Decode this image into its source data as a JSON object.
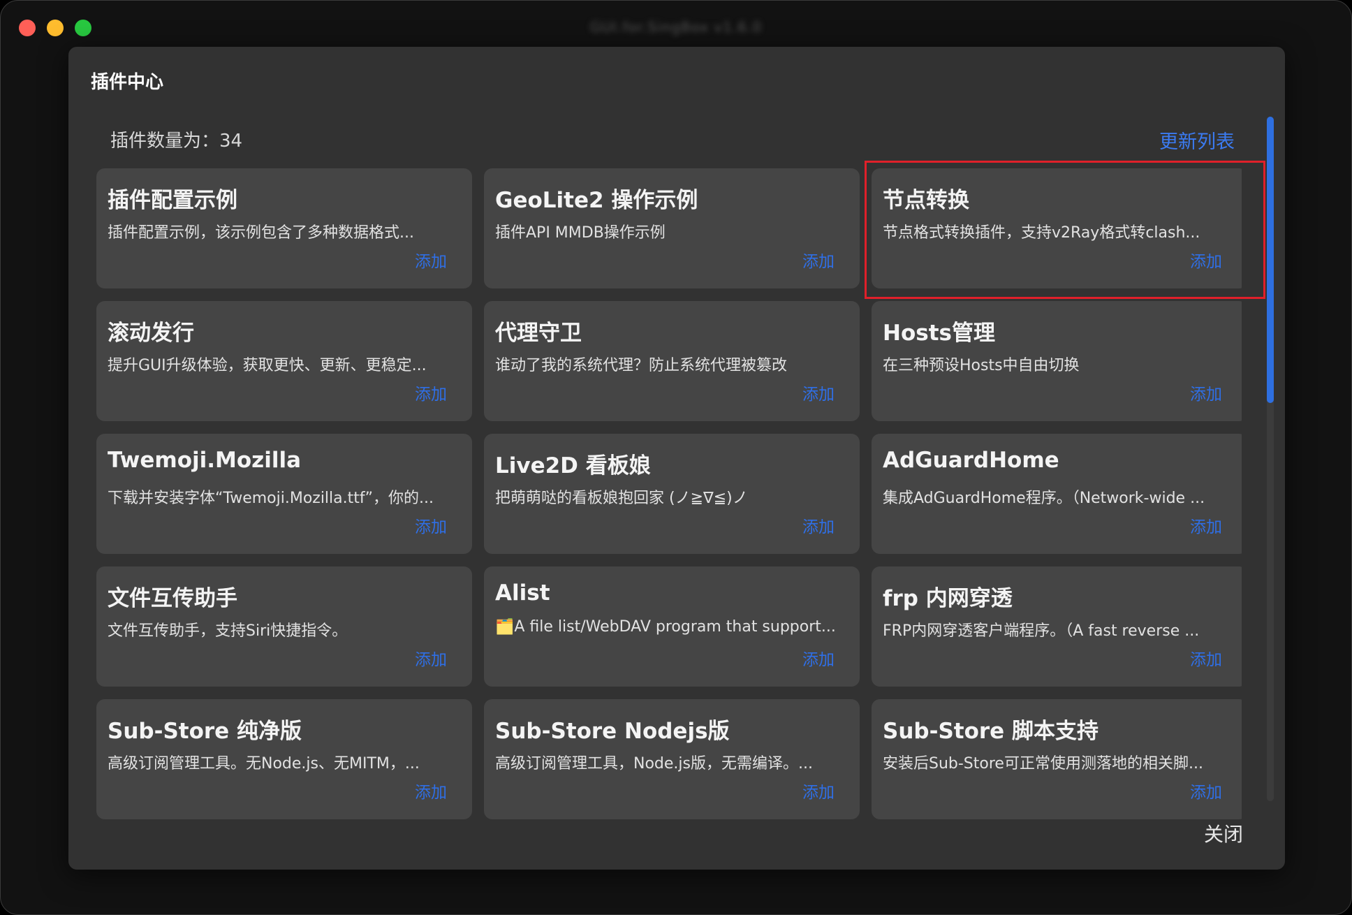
{
  "window": {
    "title": "GUI.for.SingBox v1.6.0",
    "controls": {
      "close": "close",
      "minimize": "minimize",
      "zoom": "zoom"
    },
    "colors": {
      "close": "#ff5f57",
      "minimize": "#febc2e",
      "zoom": "#28c840"
    }
  },
  "dialog": {
    "title": "插件中心",
    "count_text": "插件数量为：34",
    "refresh_label": "更新列表",
    "close_label": "关闭"
  },
  "plugins": [
    {
      "title": "插件配置示例",
      "desc": "插件配置示例，该示例包含了多种数据格式...",
      "add": "添加"
    },
    {
      "title": "GeoLite2 操作示例",
      "desc": "插件API MMDB操作示例",
      "add": "添加"
    },
    {
      "title": "节点转换",
      "desc": "节点格式转换插件，支持v2Ray格式转clash...",
      "add": "添加",
      "highlighted": true
    },
    {
      "title": "滚动发行",
      "desc": "提升GUI升级体验，获取更快、更新、更稳定...",
      "add": "添加"
    },
    {
      "title": "代理守卫",
      "desc": "谁动了我的系统代理？防止系统代理被篡改",
      "add": "添加"
    },
    {
      "title": "Hosts管理",
      "desc": "在三种预设Hosts中自由切换",
      "add": "添加"
    },
    {
      "title": "Twemoji.Mozilla",
      "desc": "下载并安装字体“Twemoji.Mozilla.ttf”，你的...",
      "add": "添加"
    },
    {
      "title": "Live2D 看板娘",
      "desc": "把萌萌哒的看板娘抱回家 (ノ≧∇≦)ノ",
      "add": "添加"
    },
    {
      "title": "AdGuardHome",
      "desc": "集成AdGuardHome程序。（Network-wide ...",
      "add": "添加"
    },
    {
      "title": "文件互传助手",
      "desc": "文件互传助手，支持Siri快捷指令。",
      "add": "添加"
    },
    {
      "title": "Alist",
      "desc": "🗂️A file list/WebDAV program that support...",
      "add": "添加"
    },
    {
      "title": "frp 内网穿透",
      "desc": "FRP内网穿透客户端程序。（A fast reverse ...",
      "add": "添加"
    },
    {
      "title": "Sub-Store 纯净版",
      "desc": "高级订阅管理工具。无Node.js、无MITM，...",
      "add": "添加"
    },
    {
      "title": "Sub-Store Nodejs版",
      "desc": "高级订阅管理工具，Node.js版，无需编译。...",
      "add": "添加"
    },
    {
      "title": "Sub-Store 脚本支持",
      "desc": "安装后Sub-Store可正常使用测落地的相关脚...",
      "add": "添加"
    }
  ],
  "colors": {
    "accent": "#3b7bf2",
    "card_bg": "#454545",
    "dialog_bg": "#323232",
    "highlight": "#e0202a"
  }
}
